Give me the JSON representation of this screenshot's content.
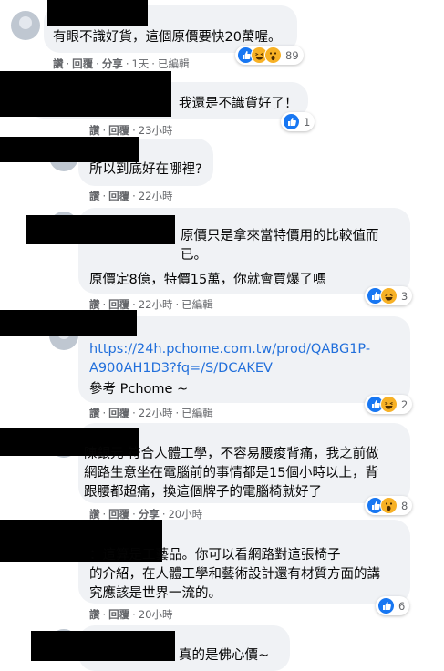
{
  "comments": [
    {
      "text": "有眼不識好貨，這個原價要快20萬喔。",
      "actions": [
        "讚",
        "回覆",
        "分享"
      ],
      "time": "1天",
      "edited": "已編輯",
      "reactions": [
        "like",
        "haha",
        "wow"
      ],
      "reaction_count": "89"
    },
    {
      "text": "我還是不識貨好了！",
      "actions": [
        "讚",
        "回覆"
      ],
      "time": "23小時",
      "edited": "",
      "reactions": [
        "like"
      ],
      "reaction_count": "1"
    },
    {
      "text": "所以到底好在哪裡?",
      "actions": [
        "讚",
        "回覆"
      ],
      "time": "22小時",
      "edited": "",
      "reactions": [],
      "reaction_count": ""
    },
    {
      "text": "原價只是拿來當特價用的比較值而\n已。",
      "text2": "原價定8億，特價15萬，你就會買爆了嗎",
      "actions": [
        "讚",
        "回覆"
      ],
      "time": "22小時",
      "edited": "已編輯",
      "reactions": [
        "like",
        "haha"
      ],
      "reaction_count": "3"
    },
    {
      "link": "https://24h.pchome.com.tw/prod/QABG1P-\nA900AH1D3?fq=/S/DCAKEV",
      "text2": "參考 Pchome ~",
      "actions": [
        "讚",
        "回覆"
      ],
      "time": "22小時",
      "edited": "已編輯",
      "reactions": [
        "like",
        "haha"
      ],
      "reaction_count": "2"
    },
    {
      "text": "陳銀元 符合人體工學，不容易腰痠背痛，我之前做\n網路生意坐在電腦前的事情都是15個小時以上，背\n跟腰都超痛，換這個牌子的電腦椅就好了",
      "actions": [
        "讚",
        "回覆",
        "分享"
      ],
      "time": "20小時",
      "edited": "",
      "reactions": [
        "like",
        "wow"
      ],
      "reaction_count": "8"
    },
    {
      "text": "：這算是工藝品。你可以看網路對這張椅子\n的介紹，在人體工學和藝術設計還有材質方面的講\n究應該是世界一流的。",
      "actions": [
        "讚",
        "回覆"
      ],
      "time": "20小時",
      "edited": "",
      "reactions": [
        "like"
      ],
      "reaction_count": "6"
    },
    {
      "text": "真的是佛心價~",
      "actions": [],
      "time": "",
      "edited": "",
      "reactions": [],
      "reaction_count": ""
    }
  ]
}
